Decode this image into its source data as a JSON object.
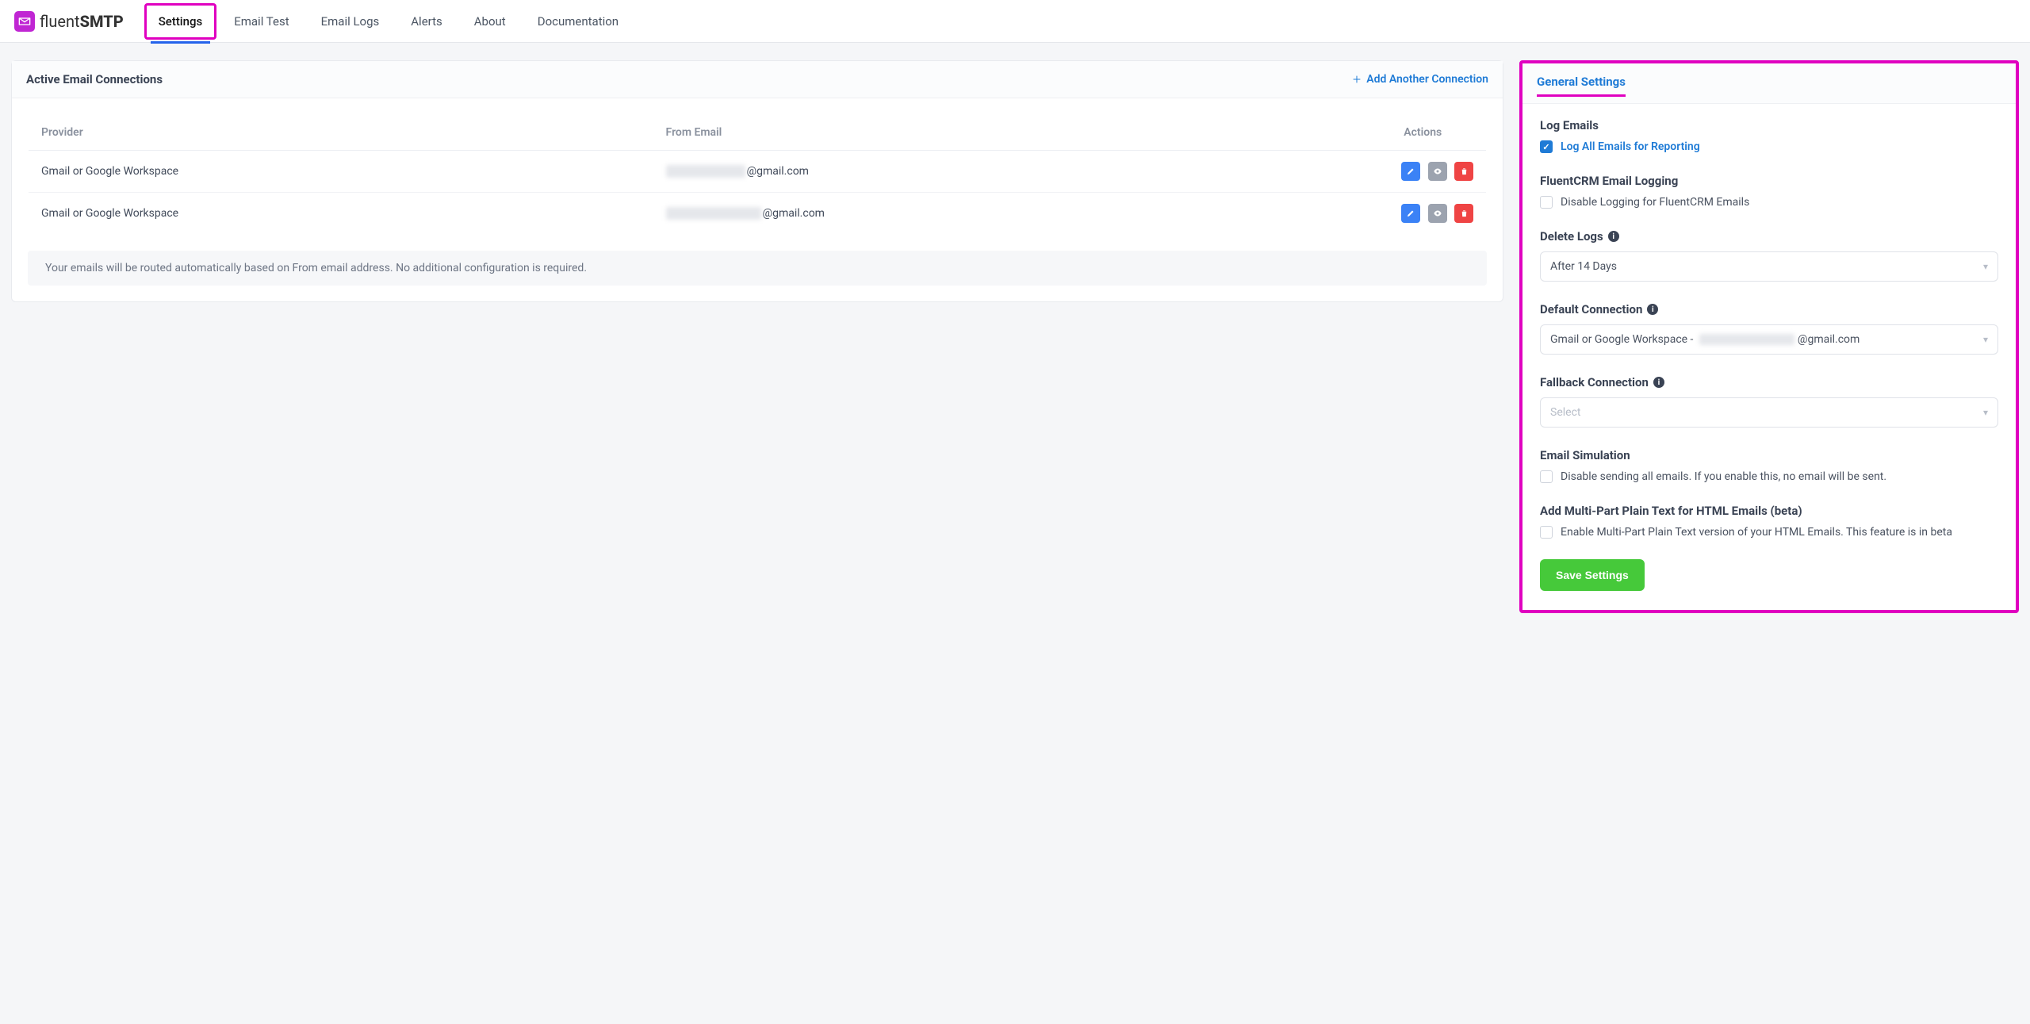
{
  "brand": {
    "name_light": "fluent",
    "name_bold": "SMTP"
  },
  "tabs": [
    {
      "label": "Settings",
      "active": true
    },
    {
      "label": "Email Test"
    },
    {
      "label": "Email Logs"
    },
    {
      "label": "Alerts"
    },
    {
      "label": "About"
    },
    {
      "label": "Documentation"
    }
  ],
  "connections": {
    "title": "Active Email Connections",
    "add_label": "Add Another Connection",
    "columns": {
      "provider": "Provider",
      "from_email": "From Email",
      "actions": "Actions"
    },
    "rows": [
      {
        "provider": "Gmail or Google Workspace",
        "email_suffix": "@gmail.com"
      },
      {
        "provider": "Gmail or Google Workspace",
        "email_suffix": "@gmail.com"
      }
    ],
    "note": "Your emails will be routed automatically based on From email address. No additional configuration is required."
  },
  "general": {
    "title": "General Settings",
    "log_emails": {
      "heading": "Log Emails",
      "checkbox": "Log All Emails for Reporting",
      "checked": true
    },
    "fluentcrm": {
      "heading": "FluentCRM Email Logging",
      "checkbox": "Disable Logging for FluentCRM Emails",
      "checked": false
    },
    "delete_logs": {
      "heading": "Delete Logs",
      "value": "After 14 Days"
    },
    "default_conn": {
      "heading": "Default Connection",
      "value_prefix": "Gmail or Google Workspace - ",
      "value_suffix": "@gmail.com"
    },
    "fallback_conn": {
      "heading": "Fallback Connection",
      "placeholder": "Select"
    },
    "simulation": {
      "heading": "Email Simulation",
      "checkbox": "Disable sending all emails. If you enable this, no email will be sent.",
      "checked": false
    },
    "multipart": {
      "heading": "Add Multi-Part Plain Text for HTML Emails (beta)",
      "checkbox": "Enable Multi-Part Plain Text version of your HTML Emails. This feature is in beta",
      "checked": false
    },
    "save": "Save Settings"
  }
}
